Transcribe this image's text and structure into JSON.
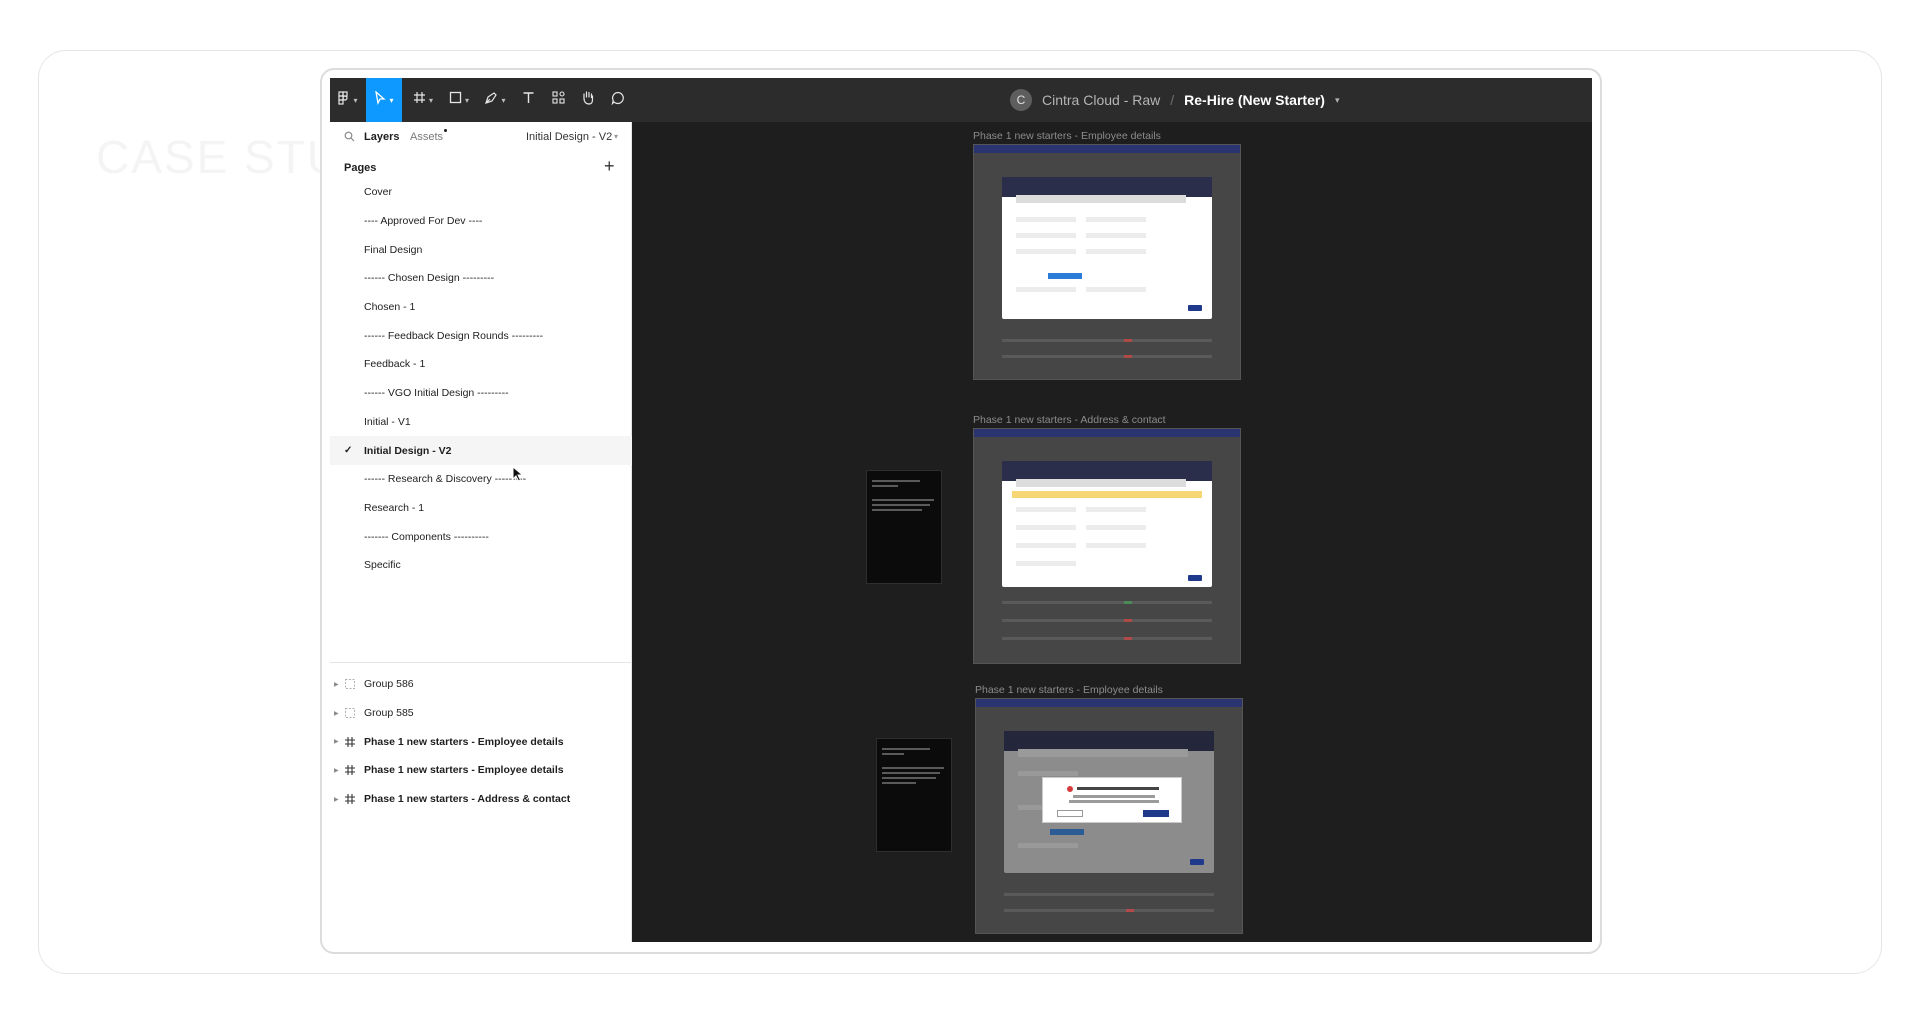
{
  "background_text": "CASE STUD",
  "toolbar": {
    "tools": [
      {
        "name": "main-menu",
        "glyph": "▦",
        "has_dropdown": true
      },
      {
        "name": "move-tool",
        "glyph": "➤",
        "has_dropdown": true,
        "active": true
      },
      {
        "name": "frame-tool",
        "glyph": "#",
        "has_dropdown": true
      },
      {
        "name": "shape-tool",
        "glyph": "□",
        "has_dropdown": true
      },
      {
        "name": "pen-tool",
        "glyph": "✎",
        "has_dropdown": true
      },
      {
        "name": "text-tool",
        "glyph": "T",
        "has_dropdown": false
      },
      {
        "name": "resources-tool",
        "glyph": "⁘",
        "has_dropdown": false
      },
      {
        "name": "hand-tool",
        "glyph": "✋",
        "has_dropdown": false
      },
      {
        "name": "comment-tool",
        "glyph": "◯",
        "has_dropdown": false
      }
    ],
    "avatar_initial": "C",
    "project_name": "Cintra Cloud - Raw",
    "separator": "/",
    "file_name": "Re-Hire (New Starter)",
    "accent_color": "#0d99ff"
  },
  "panel": {
    "tab_layers": "Layers",
    "tab_assets": "Assets",
    "current_page": "Initial Design - V2",
    "pages_header": "Pages",
    "pages": [
      {
        "label": "Cover",
        "selected": false
      },
      {
        "label": "---- Approved For Dev ----",
        "selected": false
      },
      {
        "label": "Final Design",
        "selected": false
      },
      {
        "label": "------ Chosen Design ---------",
        "selected": false
      },
      {
        "label": "Chosen - 1",
        "selected": false
      },
      {
        "label": "------ Feedback Design Rounds ---------",
        "selected": false
      },
      {
        "label": "Feedback - 1",
        "selected": false
      },
      {
        "label": "------ VGO Initial Design ---------",
        "selected": false
      },
      {
        "label": "Initial  - V1",
        "selected": false
      },
      {
        "label": "Initial Design - V2",
        "selected": true
      },
      {
        "label": "------ Research & Discovery ---------",
        "selected": false
      },
      {
        "label": "Research - 1",
        "selected": false
      },
      {
        "label": "------- Components ----------",
        "selected": false
      },
      {
        "label": "Specific",
        "selected": false
      }
    ],
    "layers": [
      {
        "label": "Group 586",
        "type": "group",
        "bold": false
      },
      {
        "label": "Group 585",
        "type": "group",
        "bold": false
      },
      {
        "label": "Phase 1 new starters - Employee details",
        "type": "frame",
        "bold": true
      },
      {
        "label": "Phase 1 new starters - Employee details",
        "type": "frame",
        "bold": true
      },
      {
        "label": "Phase 1 new starters - Address & contact",
        "type": "frame",
        "bold": true
      }
    ]
  },
  "canvas": {
    "frames": [
      {
        "title": "Phase 1 new starters - Employee details"
      },
      {
        "title": "Phase 1 new starters - Address & contact"
      },
      {
        "title": "Phase 1 new starters - Employee details"
      }
    ]
  }
}
